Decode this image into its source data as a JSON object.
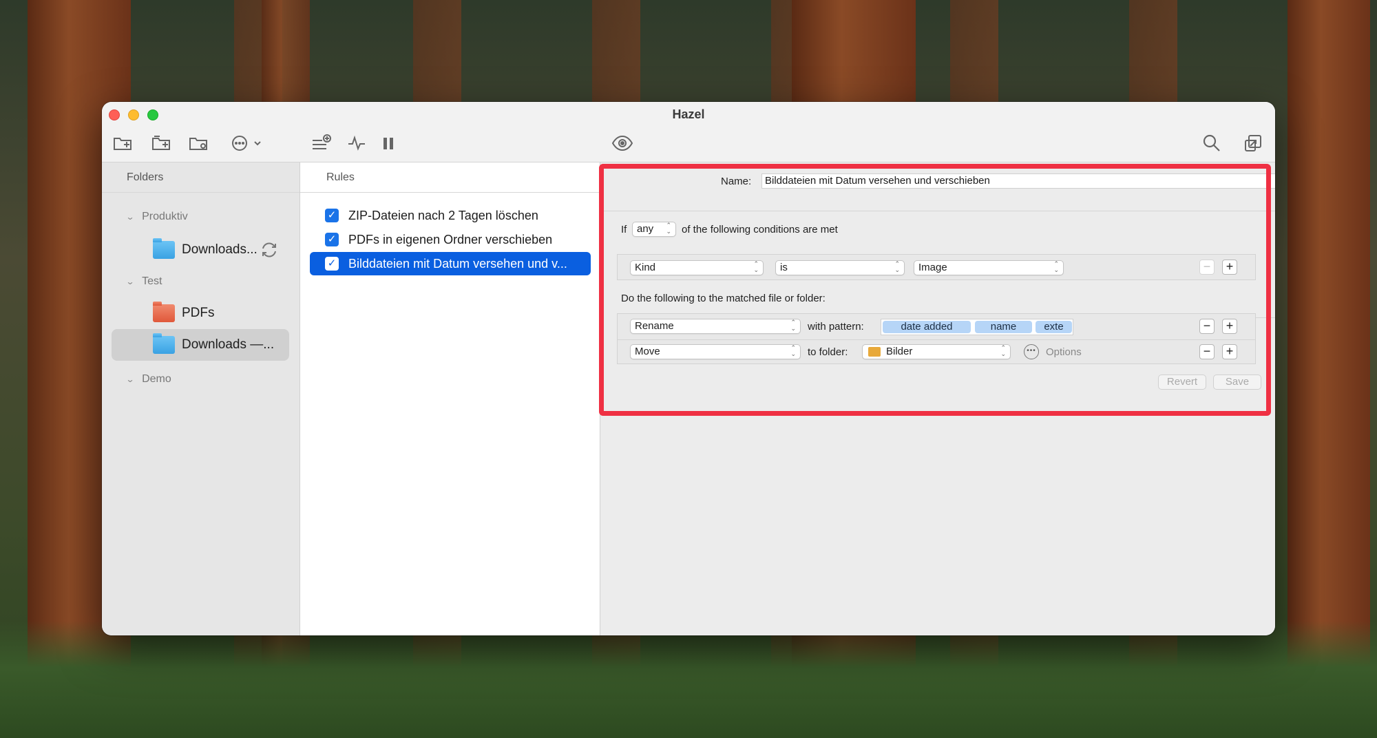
{
  "window": {
    "title": "Hazel"
  },
  "folders_pane": {
    "header": "Folders",
    "groups": [
      {
        "label": "Produktiv",
        "items": [
          {
            "label": "Downloads..."
          }
        ]
      },
      {
        "label": "Test",
        "items": [
          {
            "label": "PDFs"
          },
          {
            "label": "Downloads —..."
          }
        ]
      },
      {
        "label": "Demo",
        "items": []
      }
    ]
  },
  "rules_pane": {
    "header": "Rules",
    "rules": [
      {
        "label": "ZIP-Dateien nach 2 Tagen löschen",
        "checked": true
      },
      {
        "label": "PDFs in eigenen Ordner verschieben",
        "checked": true
      },
      {
        "label": "Bilddateien mit Datum versehen und v...",
        "checked": true,
        "selected": true
      }
    ]
  },
  "detail": {
    "name_label": "Name:",
    "name_value": "Bilddateien mit Datum versehen und verschieben",
    "if_label": "If",
    "match_mode": "any",
    "conditions_suffix": "of the following conditions are met",
    "condition": {
      "attribute": "Kind",
      "operator": "is",
      "value": "Image"
    },
    "actions_label": "Do the following to the matched file or folder:",
    "actions": [
      {
        "action": "Rename",
        "connector": "with pattern:",
        "tokens": [
          "date added",
          "name",
          "exte"
        ]
      },
      {
        "action": "Move",
        "connector": "to folder:",
        "target": "Bilder",
        "options_label": "Options"
      }
    ],
    "revert_label": "Revert",
    "save_label": "Save"
  },
  "colors": {
    "selection": "#0a5fe0",
    "highlight_border": "#ef3043",
    "token": "#b6d5f7"
  }
}
